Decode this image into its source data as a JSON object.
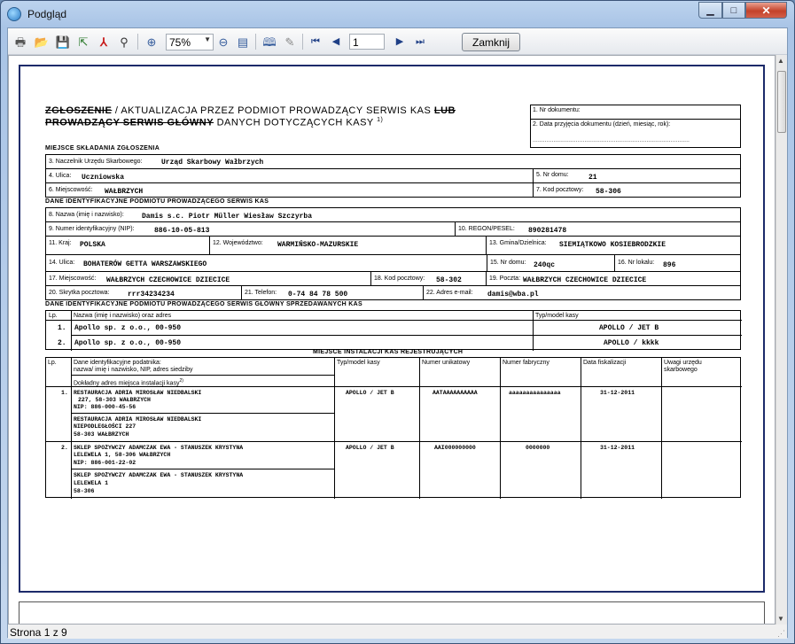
{
  "window": {
    "title": "Podgląd"
  },
  "toolbar": {
    "zoom": "75%",
    "page": "1",
    "close_label": "Zamknij"
  },
  "status": {
    "text": "Strona 1 z 9"
  },
  "form": {
    "hdr_a": "ZGŁOSZENIE",
    "hdr_b": " / AKTUALIZACJA PRZEZ PODMIOT PROWADZĄCY SERWIS KAS ",
    "hdr_c": "LUB",
    "hdr_d": "PROWADZĄCY SERWIS GŁÓWNY",
    "hdr_e": " DANYCH DOTYCZĄCYCH KASY ",
    "hdr_sup": "1)",
    "f1": "1. Nr dokumentu:",
    "f2": "2. Data przyjęcia dokumentu (dzień, miesiąc, rok):",
    "f2_dots": "...........................................................................................",
    "sec1": "MIEJSCE SKŁADANIA ZGŁOSZENIA",
    "f3_l": "3. Naczelnik Urzędu Skarbowego:",
    "f3_v": "Urząd Skarbowy Wałbrzych",
    "f4_l": "4. Ulica:",
    "f4_v": "Uczniowska",
    "f5_l": "5. Nr domu:",
    "f5_v": "21",
    "f6_l": "6. Miejscowość:",
    "f6_v": "WAŁBRZYCH",
    "f7_l": "7. Kod pocztowy:",
    "f7_v": "58-306",
    "sec2": "DANE IDENTYFIKACYJNE PODMIOTU PROWADZĄCEGO SERWIS KAS",
    "f8_l": "8. Nazwa (imię i nazwisko):",
    "f8_v": "Damis s.c. Piotr Müller Wiesław Szczyrba",
    "f9_l": "9. Numer identyfikacyjny (NIP):",
    "f9_v": "886-10-05-813",
    "f10_l": "10. REGON/PESEL:",
    "f10_v": "890281478",
    "f11_l": "11. Kraj:",
    "f11_v": "POLSKA",
    "f12_l": "12. Województwo:",
    "f12_v": "WARMIŃSKO-MAZURSKIE",
    "f13_l": "13. Gmina/Dzielnica:",
    "f13_v": "SIEMIĄTKOWO KOSIEBRODZKIE",
    "f14_l": "14. Ulica:",
    "f14_v": "BOHATERÓW GETTA WARSZAWSKIEGO",
    "f15_l": "15. Nr domu:",
    "f15_v": "240qc",
    "f16_l": "16. Nr lokalu:",
    "f16_v": "896",
    "f17_l": "17. Miejscowość:",
    "f17_v": "WAŁBRZYCH CZECHOWICE DZIECICE",
    "f18_l": "18. Kod pocztowy:",
    "f18_v": "58-302",
    "f19_l": "19. Poczta:",
    "f19_v": "WAŁBRZYCH CZECHOWICE DZIECICE",
    "f20_l": "20. Skrytka pocztowa:",
    "f20_v": "rrr34234234",
    "f21_l": "21. Telefon:",
    "f21_v": "0-74 84 78 500",
    "f22_l": "22. Adres e-mail:",
    "f22_v": "damis@wba.pl",
    "sec3": "DANE IDENTYFIKACYJNE PODMIOTU PROWADZĄCEGO SERWIS GŁÓWNY SPRZEDAWANYCH KAS",
    "t1_h_lp": "Lp.",
    "t1_h_name": "Nazwa (imię i nazwisko) oraz adres",
    "t1_h_model": "Typ/model kasy",
    "t1_rows": [
      {
        "lp": "1.",
        "name": "Apollo sp. z o.o.,    00-950",
        "model": "APOLLO / JET B"
      },
      {
        "lp": "2.",
        "name": "Apollo sp. z o.o.,    00-950",
        "model": "APOLLO / kkkk"
      }
    ],
    "sec4": "MIEJSCE INSTALACJI KAS REJESTRUJĄCYCH",
    "t2_h_lp": "Lp.",
    "t2_h_name1": "Dane identyfikacyjne podatnika:",
    "t2_h_name2": "nazwa/ imię i nazwisko, NIP, adres siedziby",
    "t2_h_name3": "Dokładny adres miejsca instalacji kasy",
    "t2_h_sup": "2)",
    "t2_h_model": "Typ/model kasy",
    "t2_h_unik": "Numer unikatowy",
    "t2_h_fab": "Numer fabryczny",
    "t2_h_date": "Data fiskalizacji",
    "t2_h_uwagi": "Uwagi urzędu skarbowego",
    "t2_rows": [
      {
        "lp": "1.",
        "p1": "RESTAURACJA ADRIA MIROSŁAW NIEDBALSKI",
        "p2": "227, 58-303 WAŁBRZYCH",
        "p3": "NIP: 886-000-45-56",
        "i1": "RESTAURACJA ADRIA MIROSŁAW NIEDBALSKI",
        "i2": "NIEPODLEGŁOŚCI 227",
        "i3": "58-303 WAŁBRZYCH",
        "model": "APOLLO / JET B",
        "unik": "AATAAAAAAAAAA",
        "fab": "aaaaaaaaaaaaaaa",
        "date": "31-12-2011"
      },
      {
        "lp": "2.",
        "p1": "SKLEP SPOŻYWCZY ADAMCZAK EWA - STANUSZEK KRYSTYNA",
        "p2": "LELEWELA 1, 58-306 WAŁBRZYCH",
        "p3": "NIP: 886-001-22-02",
        "i1": "SKLEP SPOŻYWCZY ADAMCZAK EWA - STANUSZEK KRYSTYNA",
        "i2": "LELEWELA 1",
        "i3": "58-306",
        "model": "APOLLO / JET B",
        "unik": "AAI000000000",
        "fab": "0000000",
        "date": "31-12-2011"
      }
    ]
  }
}
